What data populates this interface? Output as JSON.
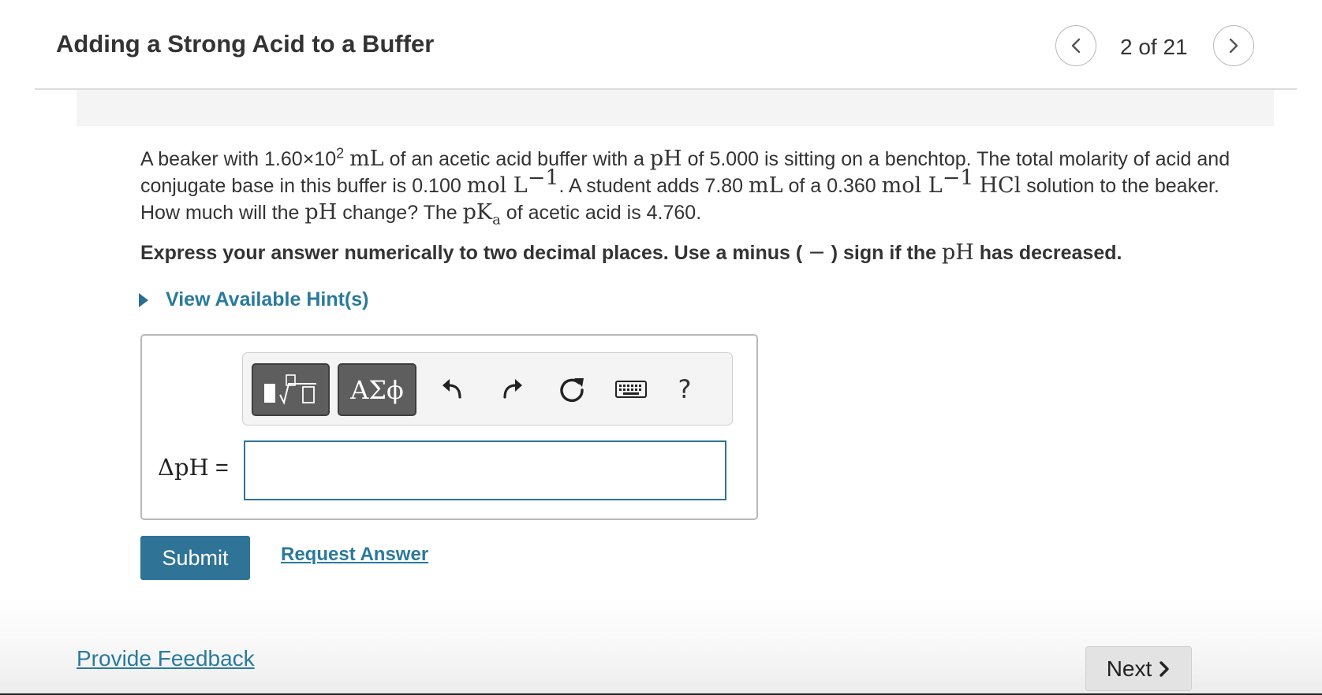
{
  "header": {
    "title": "Adding a Strong Acid to a Buffer",
    "counter": "2 of 21",
    "prev_icon": "chevron-left-icon",
    "next_icon": "chevron-right-icon"
  },
  "question": {
    "p1": "A beaker with 1.60×10",
    "p1_exp": "2",
    "p1_unit": "mL",
    "p2": " of an acetic acid buffer with a ",
    "pH": "pH",
    "p3": " of 5.000 is sitting on a benchtop. The total molarity of acid and conjugate base in this buffer is 0.100 ",
    "conc_unit": "mol L",
    "conc_exp": "−1",
    "p4": ". A student adds 7.80 ",
    "vol_unit": "mL",
    "p5": " of a 0.360 ",
    "conc_unit2": "mol L",
    "conc_exp2": "−1",
    "hcl": "HCl",
    "p6": " solution to the beaker. How much will the ",
    "pH2": "pH",
    "p7": " change? The ",
    "pKa": "pK",
    "pKa_sub": "a",
    "p8": " of acetic acid is 4.760."
  },
  "instruction": {
    "a": "Express your answer numerically to two decimal places. Use a minus ( ",
    "minus": "−",
    "b": " ) sign if the ",
    "pH": "pH",
    "c": " has decreased."
  },
  "hints": {
    "label": "View Available Hint(s)"
  },
  "toolbar": {
    "templates_icon": "templates-icon",
    "symbols_label": "ΑΣϕ",
    "undo_icon": "undo-icon",
    "redo_icon": "redo-icon",
    "reset_icon": "reset-icon",
    "keyboard_icon": "keyboard-icon",
    "help_label": "?"
  },
  "answer": {
    "label_prefix": "ΔpH",
    "label_eq": " = ",
    "value": "",
    "placeholder": ""
  },
  "actions": {
    "submit_label": "Submit",
    "request_label": "Request Answer"
  },
  "footer": {
    "feedback_label": "Provide Feedback",
    "next_label": "Next"
  },
  "colors": {
    "accent": "#2f7396",
    "link": "#2a7a9c",
    "toolbar_button": "#5e5e5e"
  }
}
